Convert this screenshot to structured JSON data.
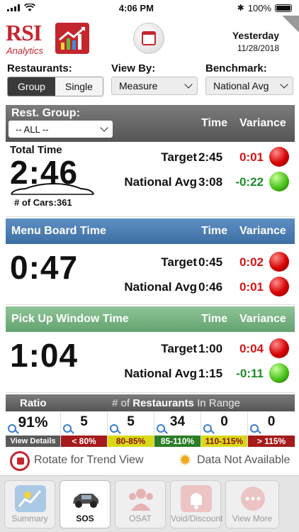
{
  "status": {
    "time": "4:06 PM",
    "battery": "100%"
  },
  "header": {
    "logo_title": "RSI",
    "logo_subtitle": "Analytics",
    "date_label": "Yesterday",
    "date_value": "11/28/2018"
  },
  "filters": {
    "restaurants_label": "Restaurants:",
    "group_label": "Group",
    "single_label": "Single",
    "view_by_label": "View By:",
    "view_by_value": "Measure",
    "benchmark_label": "Benchmark:",
    "benchmark_value": "National Avg"
  },
  "total": {
    "group_label": "Rest. Group:",
    "group_value": "-- ALL --",
    "time_header": "Time",
    "variance_header": "Variance",
    "title": "Total Time",
    "value": "2:46",
    "cars_label": "# of Cars:",
    "cars_value": "361",
    "rows": [
      {
        "label": "Target",
        "time": "2:45",
        "variance": "0:01",
        "status": "red"
      },
      {
        "label": "National Avg",
        "time": "3:08",
        "variance": "-0:22",
        "status": "green"
      }
    ]
  },
  "menu_board": {
    "title": "Menu Board Time",
    "time_header": "Time",
    "variance_header": "Variance",
    "value": "0:47",
    "rows": [
      {
        "label": "Target",
        "time": "0:45",
        "variance": "0:02",
        "status": "red"
      },
      {
        "label": "National Avg",
        "time": "0:46",
        "variance": "0:01",
        "status": "red"
      }
    ]
  },
  "pickup": {
    "title": "Pick Up Window Time",
    "time_header": "Time",
    "variance_header": "Variance",
    "value": "1:04",
    "rows": [
      {
        "label": "Target",
        "time": "1:00",
        "variance": "0:04",
        "status": "red"
      },
      {
        "label": "National Avg",
        "time": "1:15",
        "variance": "-0:11",
        "status": "green"
      }
    ]
  },
  "ratio": {
    "ratio_label": "Ratio",
    "range_prefix": "# of",
    "range_bold": "Restaurants",
    "range_suffix": "In Range",
    "ratio_value": "91%",
    "view_details": "View Details",
    "bins": [
      {
        "count": "5",
        "label": "< 80%",
        "color": "#a51b1b",
        "text_color": "#ffffff"
      },
      {
        "count": "5",
        "label": "80-85%",
        "color": "#d9d91a",
        "text_color": "#8a1010"
      },
      {
        "count": "34",
        "label": "85-110%",
        "color": "#2c7d26",
        "text_color": "#ffffff"
      },
      {
        "count": "0",
        "label": "110-115%",
        "color": "#d9d91a",
        "text_color": "#8a1010"
      },
      {
        "count": "0",
        "label": "> 115%",
        "color": "#a51b1b",
        "text_color": "#ffffff"
      }
    ]
  },
  "legend": {
    "rotate_text": "Rotate for Trend View",
    "na_text": "Data Not Available"
  },
  "tabs": [
    {
      "label": "Summary",
      "icon": "summary-chart-icon",
      "color": "#8fb7d9"
    },
    {
      "label": "SOS",
      "icon": "car-icon",
      "color": "#ffffff"
    },
    {
      "label": "OSAT",
      "icon": "people-icon",
      "color": "#e6b3b3"
    },
    {
      "label": "Void/Discount",
      "icon": "bell-icon",
      "color": "#e6b3b3"
    },
    {
      "label": "View More",
      "icon": "more-dots-icon",
      "color": "#e6b3b3"
    }
  ],
  "colors": {
    "accent_red": "#c4262e",
    "blue_header": "#4f80b6",
    "green_header": "#74b080"
  }
}
